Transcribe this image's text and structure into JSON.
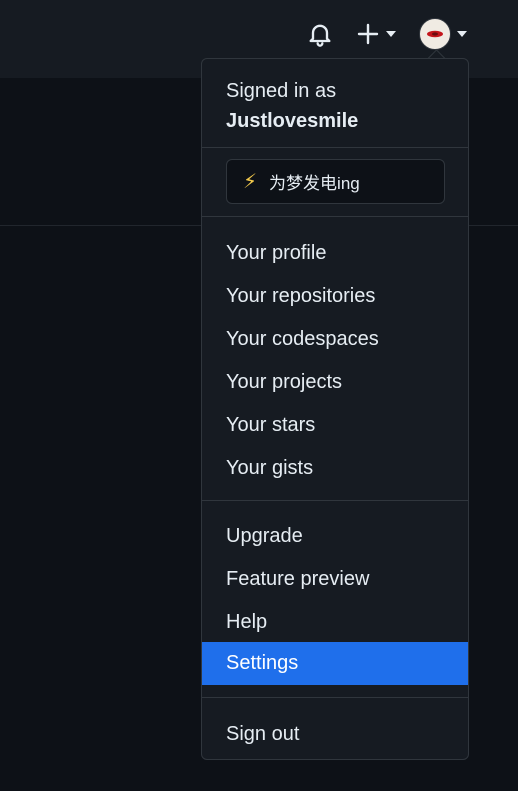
{
  "header": {
    "notifications_icon": "bell-icon",
    "create_icon": "plus-icon",
    "avatar_icon": "avatar-icon"
  },
  "menu": {
    "signed_in_label": "Signed in as",
    "username": "Justlovesmile",
    "status": {
      "emoji": "⚡",
      "text": "为梦发电ing"
    },
    "section1": [
      "Your profile",
      "Your repositories",
      "Your codespaces",
      "Your projects",
      "Your stars",
      "Your gists"
    ],
    "section2": [
      "Upgrade",
      "Feature preview",
      "Help",
      "Settings"
    ],
    "active_item": "Settings",
    "sign_out": "Sign out"
  },
  "colors": {
    "background": "#0d1117",
    "header": "#161b22",
    "accent": "#1f6feb",
    "border": "#30363d"
  }
}
